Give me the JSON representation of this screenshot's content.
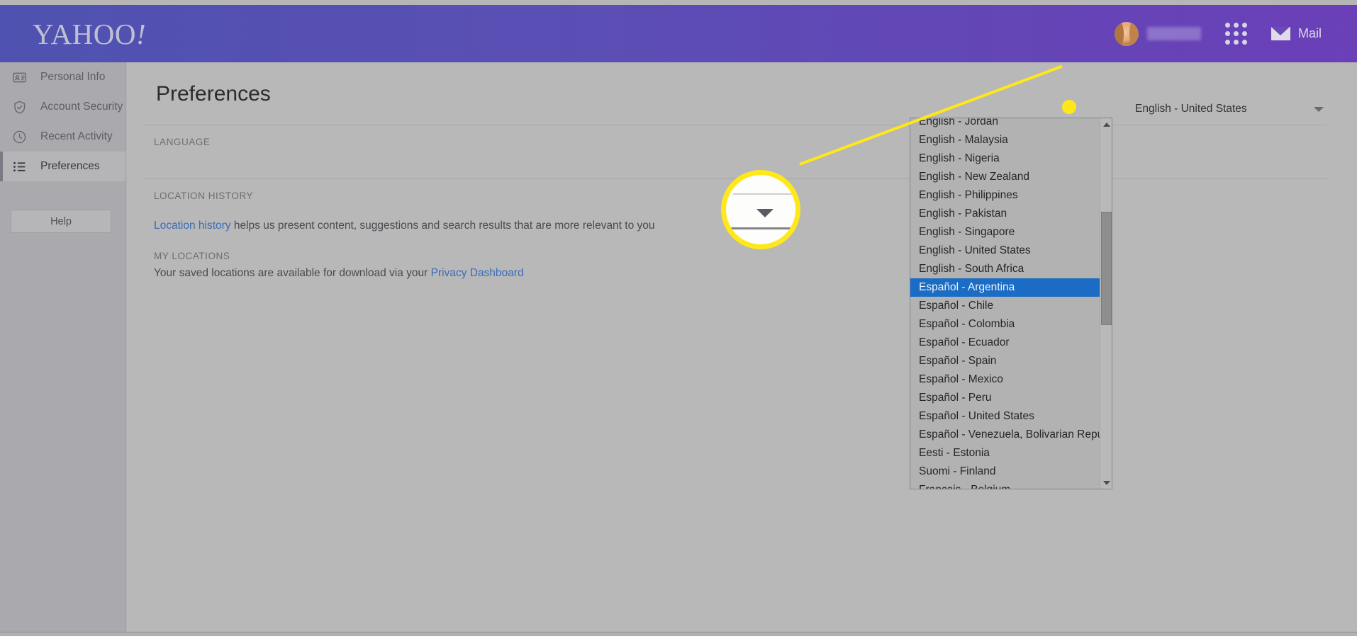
{
  "header": {
    "logo": "YAHOO",
    "logo_bang": "!",
    "apps_icon": "apps-grid-icon",
    "mail_label": "Mail",
    "mail_icon": "envelope-icon",
    "avatar_icon": "user-avatar"
  },
  "sidebar": {
    "items": [
      {
        "label": "Personal Info",
        "icon": "id-card-icon",
        "active": false
      },
      {
        "label": "Account Security",
        "icon": "shield-check-icon",
        "active": false
      },
      {
        "label": "Recent Activity",
        "icon": "clock-icon",
        "active": false
      },
      {
        "label": "Preferences",
        "icon": "list-icon",
        "active": true
      }
    ],
    "help_label": "Help"
  },
  "main": {
    "title": "Preferences",
    "language_section": {
      "label": "LANGUAGE",
      "selected_value": "English - United States",
      "caret_icon": "chevron-down-icon"
    },
    "location_history_section": {
      "label": "LOCATION HISTORY",
      "link_text": "Location history",
      "body_text": " helps us present content, suggestions and search results that are more relevant to you"
    },
    "my_locations_section": {
      "label": "MY LOCATIONS",
      "body_prefix": "Your saved locations are available for download via your ",
      "link_text": "Privacy Dashboard"
    }
  },
  "language_dropdown": {
    "options": [
      "English - Jordan",
      "English - Malaysia",
      "English - Nigeria",
      "English - New Zealand",
      "English - Philippines",
      "English - Pakistan",
      "English - Singapore",
      "English - United States",
      "English - South Africa",
      "Español - Argentina",
      "Español - Chile",
      "Español - Colombia",
      "Español - Ecuador",
      "Español - Spain",
      "Español - Mexico",
      "Español - Peru",
      "Español - United States",
      "Español - Venezuela, Bolivarian Republic Of",
      "Eesti - Estonia",
      "Suomi - Finland",
      "Français - Belgium"
    ],
    "highlighted_option": "Español - Argentina",
    "scroll_up_icon": "scroll-up-arrow-icon",
    "scroll_down_icon": "scroll-down-arrow-icon"
  },
  "annotation": {
    "type": "magnifier-callout",
    "target": "language-dropdown-caret",
    "color": "#ffe81a"
  },
  "colors": {
    "header_start": "#4f52b0",
    "header_end": "#6b3fb8",
    "highlight_blue": "#1a6cc4",
    "link_blue": "#3b6bb5",
    "annotation_yellow": "#ffe81a",
    "page_bg": "#b8b8b8",
    "sidebar_bg": "#aaaaae"
  }
}
